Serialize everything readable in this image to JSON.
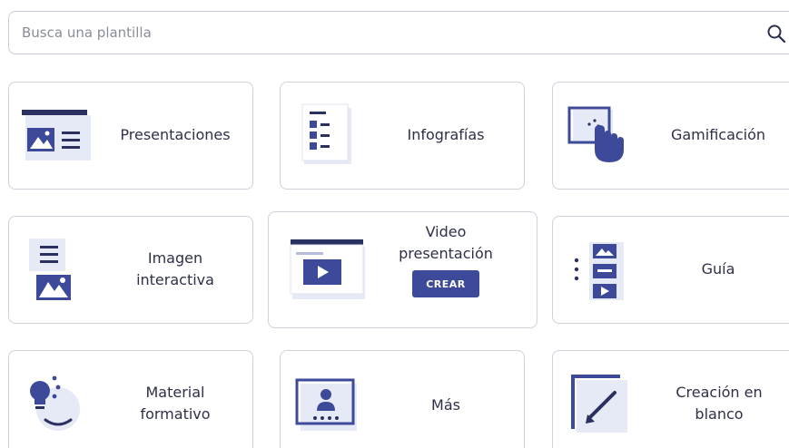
{
  "search": {
    "placeholder": "Busca una plantilla",
    "icon": "search-icon"
  },
  "accent_color": "#3d4a9a",
  "cards": [
    {
      "id": "presentaciones",
      "lines": [
        "Presentaciones"
      ],
      "icon": "presentation-icon"
    },
    {
      "id": "infografias",
      "lines": [
        "Infografías"
      ],
      "icon": "infographic-icon"
    },
    {
      "id": "gamificacion",
      "lines": [
        "Gamificación"
      ],
      "icon": "hand-click-icon"
    },
    {
      "id": "imagen-interactiva",
      "lines": [
        "Imagen",
        "interactiva"
      ],
      "icon": "interactive-image-icon"
    },
    {
      "id": "video-presentacion",
      "lines": [
        "Video",
        "presentación"
      ],
      "icon": "video-presentation-icon",
      "button": "CREAR"
    },
    {
      "id": "guia",
      "lines": [
        "Guía"
      ],
      "icon": "guide-icon"
    },
    {
      "id": "material-formativo",
      "lines": [
        "Material",
        "formativo"
      ],
      "icon": "lightbulb-icon"
    },
    {
      "id": "mas",
      "lines": [
        "Más"
      ],
      "icon": "user-card-icon"
    },
    {
      "id": "creacion-en-blanco",
      "lines": [
        "Creación en",
        "blanco"
      ],
      "icon": "pencil-icon"
    }
  ]
}
